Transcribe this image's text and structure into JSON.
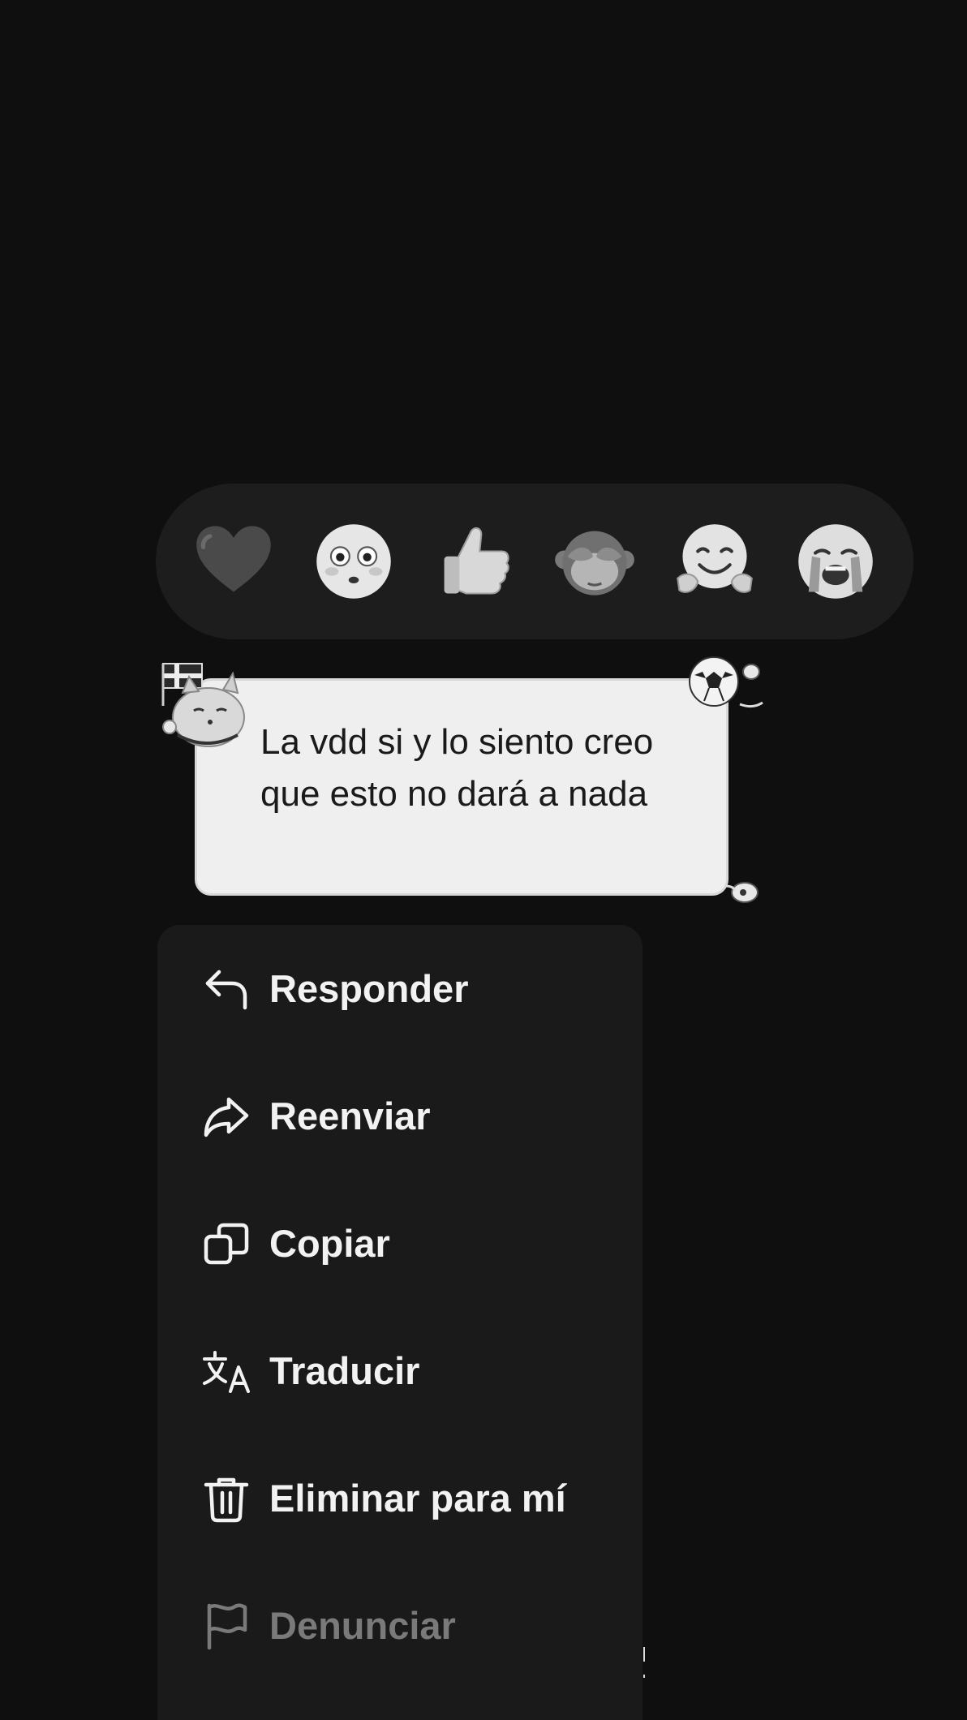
{
  "reactions": [
    {
      "name": "heart",
      "label": "Corazón"
    },
    {
      "name": "flushed-face",
      "label": "Sorprendido"
    },
    {
      "name": "thumbs-up",
      "label": "Me gusta"
    },
    {
      "name": "see-no-evil-monkey",
      "label": "Mono"
    },
    {
      "name": "hugging-face",
      "label": "Abrazo"
    },
    {
      "name": "crying-face",
      "label": "Llorando"
    }
  ],
  "message": {
    "text": "La vdd si y lo siento creo que esto no dará a nada"
  },
  "menu": {
    "items": [
      {
        "id": "reply",
        "label": "Responder",
        "icon": "reply-icon"
      },
      {
        "id": "forward",
        "label": "Reenviar",
        "icon": "forward-icon"
      },
      {
        "id": "copy",
        "label": "Copiar",
        "icon": "copy-icon"
      },
      {
        "id": "translate",
        "label": "Traducir",
        "icon": "translate-icon"
      },
      {
        "id": "delete",
        "label": "Eliminar para mí",
        "icon": "trash-icon"
      },
      {
        "id": "report",
        "label": "Denunciar",
        "icon": "flag-icon",
        "muted": true
      }
    ]
  },
  "colors": {
    "background": "#0f0f0f",
    "reaction_bar": "#1d1d1d",
    "bubble": "#efefef",
    "menu": "#1a1a1a",
    "menu_text": "#f2f2f2",
    "menu_text_muted": "#7a7a7a"
  }
}
